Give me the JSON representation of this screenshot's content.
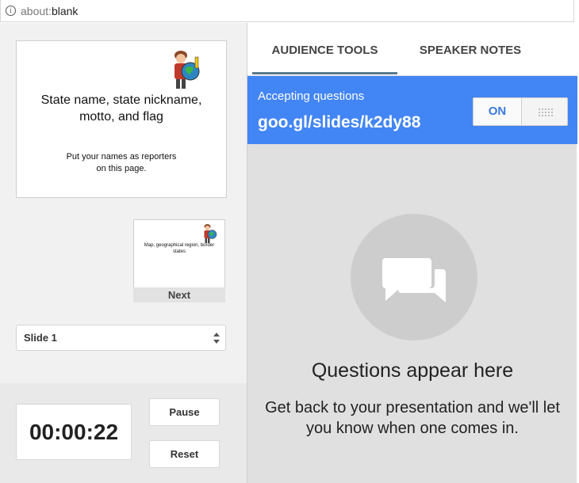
{
  "browser": {
    "url_scheme": "about:",
    "url_host": "blank"
  },
  "current_slide": {
    "title": "State name, state nickname, motto, and flag",
    "body": "Put your names as reporters on this page."
  },
  "next_slide": {
    "body": "Map, geographical region, border states",
    "label": "Next"
  },
  "slide_selector": {
    "value": "Slide 1"
  },
  "timer": {
    "value": "00:00:22",
    "pause_label": "Pause",
    "reset_label": "Reset"
  },
  "tabs": {
    "audience_tools": "AUDIENCE TOOLS",
    "speaker_notes": "SPEAKER NOTES"
  },
  "questions_bar": {
    "label": "Accepting questions",
    "link": "goo.gl/slides/k2dy88",
    "toggle_state": "ON",
    "color": "#4285f4"
  },
  "empty_state": {
    "icon": "chat-bubbles-icon",
    "title": "Questions appear here",
    "subtitle": "Get back to your presentation and we'll let you know when one comes in."
  }
}
